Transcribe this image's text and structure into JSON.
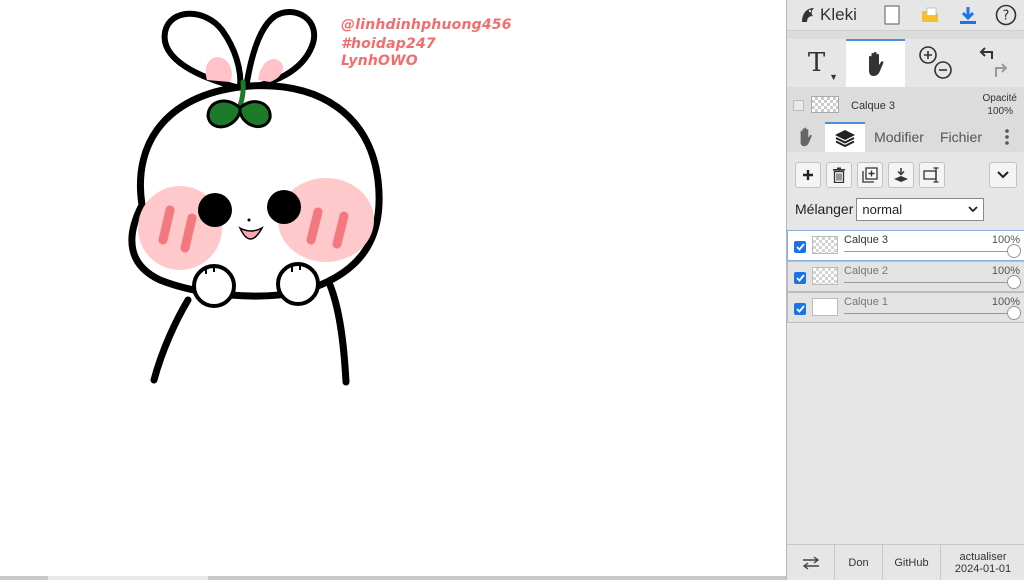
{
  "canvas": {
    "watermark": [
      "@linhdinhphuong456",
      "#hoidap247",
      "LynhOWO"
    ]
  },
  "app": {
    "name": "Kleki"
  },
  "icons": {
    "logo": "kleki-bird-icon",
    "new": "new-image-icon",
    "open": "open-folder-icon",
    "save": "download-icon",
    "help": "help-circle-icon",
    "text_tool": "text-tool-icon",
    "hand_tool": "hand-tool-icon",
    "zoom_in": "zoom-in-icon",
    "zoom_out": "zoom-out-icon",
    "undo": "undo-icon",
    "redo": "redo-icon"
  },
  "tools": {
    "text_label": "T"
  },
  "current_layer": {
    "name": "Calque 3",
    "opacity_label": "Opacité",
    "opacity_value": "100%"
  },
  "tabs": {
    "modify": "Modifier",
    "file": "Fichier"
  },
  "blend": {
    "label": "Mélanger",
    "value": "normal"
  },
  "layers": [
    {
      "name": "Calque 3",
      "opacity": "100%",
      "visible": true,
      "active": true
    },
    {
      "name": "Calque 2",
      "opacity": "100%",
      "visible": true,
      "active": false
    },
    {
      "name": "Calque 1",
      "opacity": "100%",
      "visible": true,
      "active": false
    }
  ],
  "footer": {
    "donate": "Don",
    "github": "GitHub",
    "update_line1": "actualiser",
    "update_line2": "2024-01-01"
  },
  "colors": {
    "accent": "#4a90d9",
    "checkbox": "#1a73e8",
    "watermark": "#f26e6e",
    "sprout": "#1d7a2b",
    "cheek": "#ffc9cc"
  }
}
